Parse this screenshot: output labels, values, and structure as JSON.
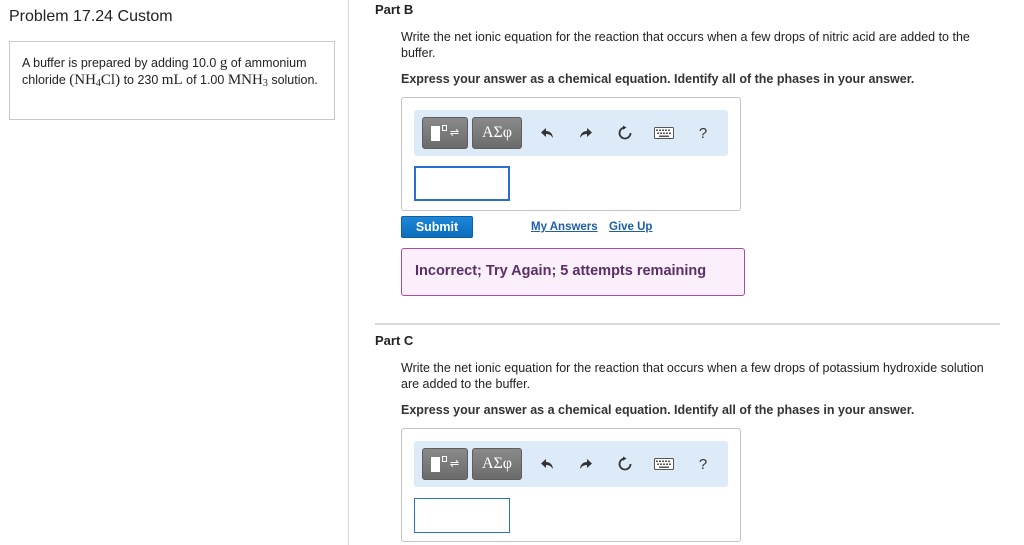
{
  "left": {
    "problem_title": "Problem 17.24 Custom",
    "problem_text": {
      "part1": "A buffer is prepared by adding 10.0 ",
      "unit_g": "g",
      "part2": " of ammonium chloride ",
      "formula_open": "(NH",
      "formula_sub": "4",
      "formula_close": "Cl)",
      "part3": " to 230 ",
      "unit_ml": "mL",
      "part4": " of 1.00 ",
      "conc": "MNH",
      "conc_sub": "3",
      "part5": " solution."
    }
  },
  "part_b": {
    "title": "Part B",
    "question": "Write the net ionic equation for the reaction that occurs when a few drops of nitric acid are added to the buffer.",
    "instruction": "Express your answer as a chemical equation. Identify all of the phases in your answer.",
    "greek_label": "ΑΣφ",
    "help_label": "?",
    "submit_label": "Submit",
    "my_answers_label": "My Answers",
    "give_up_label": "Give Up",
    "feedback": "Incorrect; Try Again; 5 attempts remaining",
    "input_value": ""
  },
  "part_c": {
    "title": "Part C",
    "question": "Write the net ionic equation for the reaction that occurs when a few drops of potassium hydroxide solution are added to the buffer.",
    "instruction": "Express your answer as a chemical equation. Identify all of the phases in your answer.",
    "greek_label": "ΑΣφ",
    "help_label": "?",
    "input_value": ""
  },
  "icons": {
    "templates": "templates-icon",
    "undo": "undo-icon",
    "redo": "redo-icon",
    "reset": "reset-icon",
    "keyboard": "keyboard-icon",
    "help": "help-icon"
  },
  "colors": {
    "toolbar_bg": "#ddeaf8",
    "submit_bg": "#0b6dbc",
    "link": "#1c5ea8",
    "feedback_bg": "#fbeffb",
    "feedback_border": "#a34ea3",
    "feedback_text": "#5a2e66",
    "input_border": "#2a6ed1"
  }
}
